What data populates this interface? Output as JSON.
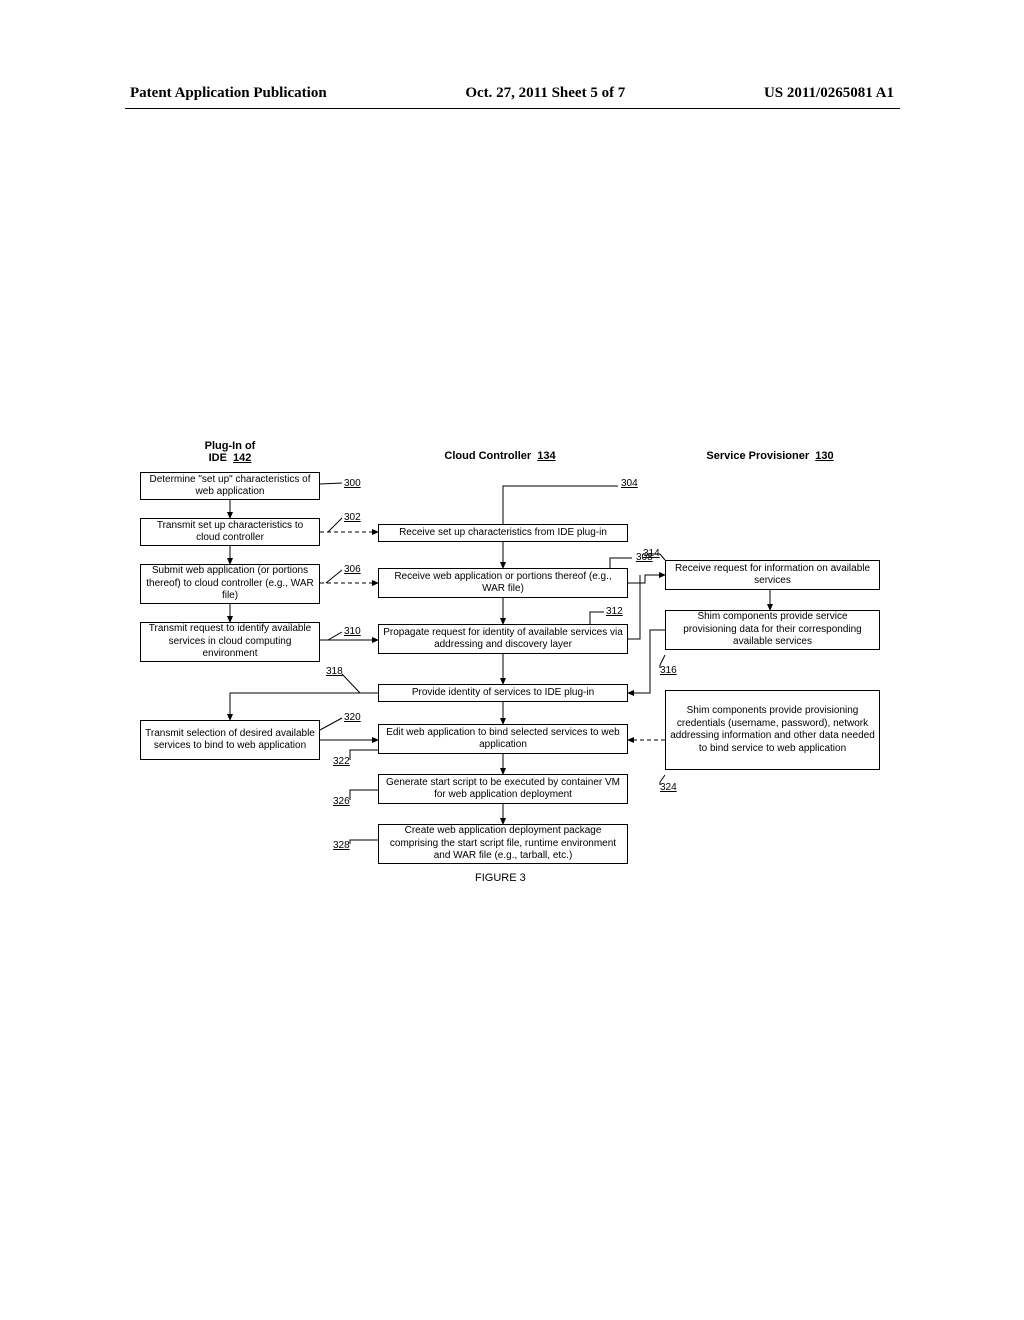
{
  "header": {
    "left": "Patent Application Publication",
    "middle": "Oct. 27, 2011  Sheet 5 of 7",
    "right": "US 2011/0265081 A1"
  },
  "columns": {
    "col1_title": "Plug-In of\nIDE",
    "col1_ref": "142",
    "col2_title": "Cloud Controller",
    "col2_ref": "134",
    "col3_title": "Service Provisioner",
    "col3_ref": "130"
  },
  "boxes": {
    "b300": "Determine \"set up\" characteristics of  web application",
    "b302": "Transmit set up characteristics to cloud controller",
    "b304": "Receive set up characteristics from IDE plug-in",
    "b306": "Submit web application (or portions thereof) to cloud controller (e.g., WAR file)",
    "b308": "Receive web application or portions thereof (e.g., WAR file)",
    "b310": "Transmit request to identify available services in cloud computing environment",
    "b312": "Propagate request for identity of available services via addressing and discovery layer",
    "b314": "Receive request for information on available services",
    "b316": "Shim components provide service provisioning data for their corresponding available services",
    "b318": "Provide identity of services to IDE plug-in",
    "b320": "Transmit selection of desired available services to bind to web application",
    "b322": "Edit web application to bind selected services to web application",
    "b324": "Shim components provide provisioning credentials (username, password), network addressing information and other data needed to bind service to web application",
    "b326": "Generate start script to be executed by container VM for web application deployment",
    "b328": "Create web application deployment package comprising the start script file, runtime environment and WAR file (e.g., tarball, etc.)"
  },
  "refs": {
    "r300": "300",
    "r302": "302",
    "r304": "304",
    "r306": "306",
    "r308": "308",
    "r310": "310",
    "r312": "312",
    "r314": "314",
    "r316": "316",
    "r318": "318",
    "r320": "320",
    "r322": "322",
    "r324": "324",
    "r326": "326",
    "r328": "328"
  },
  "figure": "FIGURE 3"
}
